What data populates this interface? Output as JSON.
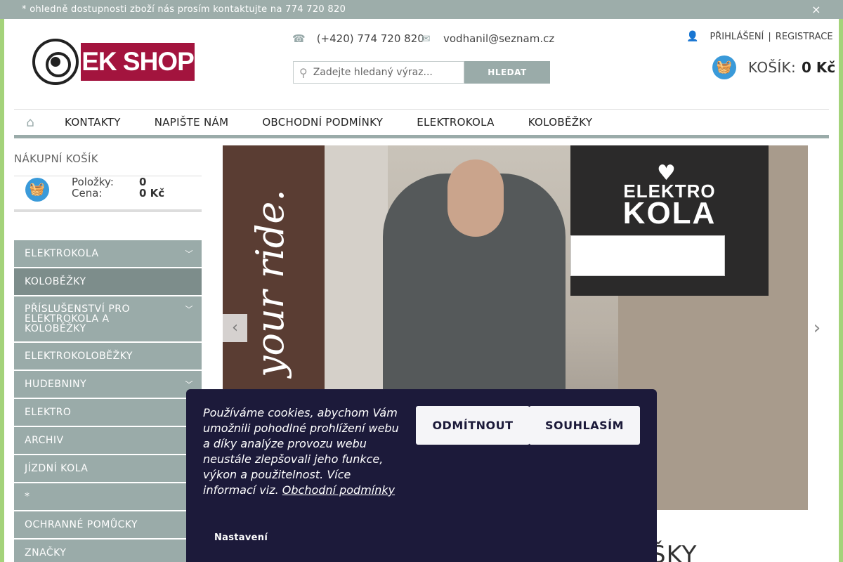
{
  "topbar": {
    "notice": "* ohledně dostupnosti zboží nás prosím kontaktujte na 774 720 820",
    "close_icon": "close-icon"
  },
  "header": {
    "logo_text": "EK SHOP",
    "phone": "(+420) 774 720 820",
    "email": "vodhanil@seznam.cz",
    "search": {
      "placeholder": "Zadejte hledaný výraz...",
      "button": "HLEDAT"
    },
    "login": "PŘIHLÁŠENÍ",
    "separator": "|",
    "register": "REGISTRACE",
    "cart": {
      "label": "KOŠÍK:",
      "value": "0 Kč"
    }
  },
  "nav": {
    "items": [
      "KONTAKTY",
      "NAPIŠTE NÁM",
      "OBCHODNÍ PODMÍNKY",
      "ELEKTROKOLA",
      "KOLOBĚŽKY"
    ]
  },
  "sidebar": {
    "cart_title": "NÁKUPNÍ KOŠÍK",
    "items_label": "Položky:",
    "items_value": "0",
    "price_label": "Cena:",
    "price_value": "0 Kč",
    "categories": [
      "ELEKTROKOLA",
      "KOLOBĚŽKY",
      "PŘÍSLUŠENSTVÍ PRO ELEKTROKOLA A KOLOBĚŽKY",
      "ELEKTROKOLOBĚŽKY",
      "HUDEBNINY",
      "ELEKTRO",
      "ARCHIV",
      "JÍZDNÍ KOLA",
      "*",
      "OCHRANNÉ POMŮCKY",
      "ZNAČKY"
    ]
  },
  "banner": {
    "script_text": "your ride.",
    "logo_line1": "ELEKTRO",
    "logo_line2": "KOLA"
  },
  "peek_text": "ŠKY",
  "cookie": {
    "text": "Používáme cookies, abychom Vám umožnili pohodlné prohlížení webu a díky analýze provozu webu neustále zlepšovali jeho funkce, výkon a použitelnost. Více informací viz.",
    "link": "Obchodní podmínky",
    "decline": "ODMÍTNOUT",
    "accept": "SOUHLASÍM",
    "settings": "Nastavení"
  },
  "colors": {
    "accent_gray": "#9aaba9",
    "brand_red": "#a3143e",
    "basket_blue": "#3a9ad9",
    "cookie_bg": "#1c1a3a",
    "page_frame": "#a4d37a"
  }
}
